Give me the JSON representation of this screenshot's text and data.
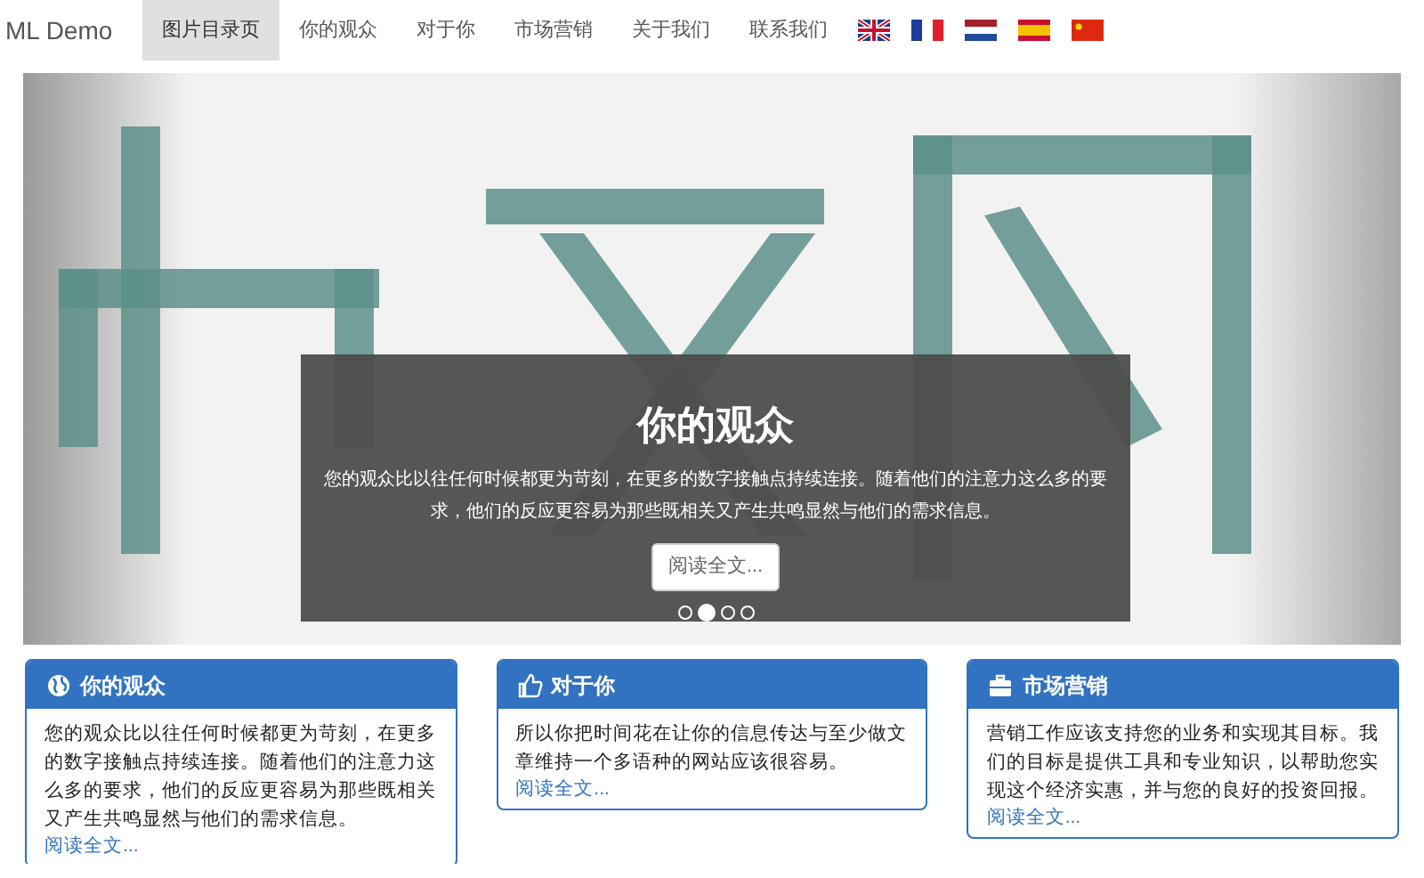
{
  "navbar": {
    "brand": "ML Demo",
    "items": [
      {
        "label": "图片目录页",
        "selected": true
      },
      {
        "label": "你的观众",
        "selected": false
      },
      {
        "label": "对于你",
        "selected": false
      },
      {
        "label": "市场营销",
        "selected": false
      },
      {
        "label": "关于我们",
        "selected": false
      },
      {
        "label": "联系我们",
        "selected": false
      }
    ],
    "flags": [
      {
        "kind": "uk"
      },
      {
        "kind": "fr"
      },
      {
        "kind": "nl"
      },
      {
        "kind": "es"
      },
      {
        "kind": "cn"
      }
    ]
  },
  "carousel": {
    "caption": {
      "title": "你的观众",
      "text": "您的观众比以往任何时候都更为苛刻，在更多的数字接触点持续连接。随着他们的注意力这么多的要求，他们的反应更容易为那些既相关又产生共鸣显然与他们的需求信息。",
      "button": "阅读全文..."
    },
    "indicators": [
      {
        "selected": false
      },
      {
        "selected": true
      },
      {
        "selected": false
      },
      {
        "selected": false
      }
    ]
  },
  "cards": [
    {
      "kind": "globe",
      "title": "你的观众",
      "text": "您的观众比以往任何时候都更为苛刻，在更多的数字接触点持续连接。随着他们的注意力这么多的要求，他们的反应更容易为那些既相关又产生共鸣显然与他们的需求信息。",
      "link": "阅读全文..."
    },
    {
      "kind": "thumb",
      "title": "对于你",
      "text": "所以你把时间花在让你的信息传达与至少做文章维持一个多语种的网站应该很容易。",
      "link": "阅读全文..."
    },
    {
      "kind": "briefcase",
      "title": "市场营销",
      "text": "营销工作应该支持您的业务和实现其目标。我们的目标是提供工具和专业知识，以帮助您实现这个经济实惠，并与您的良好的投资回报。",
      "link": "阅读全文..."
    }
  ]
}
